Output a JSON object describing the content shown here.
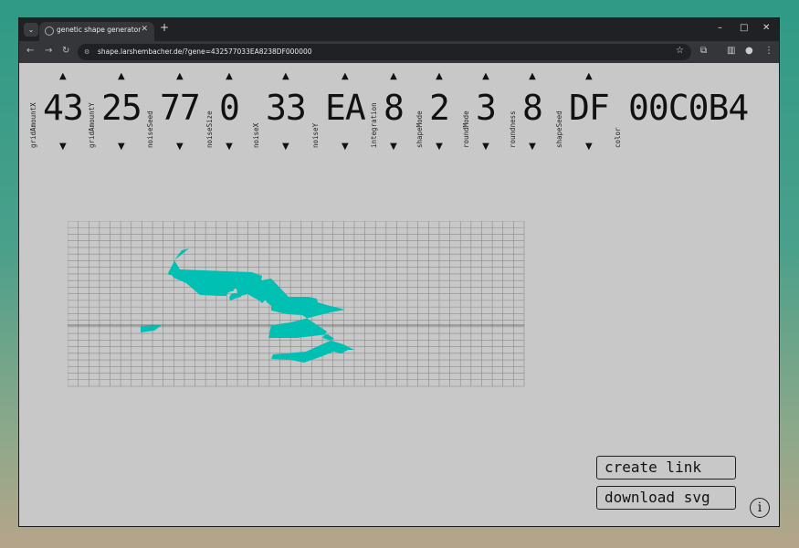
{
  "browser": {
    "tab_title": "genetic shape generator",
    "url": "shape.larshembacher.de/?gene=432577033EA8238DF000000",
    "tab_menu_icon": "chevron-down-icon",
    "new_tab_label": "+",
    "window_controls": [
      "–",
      "□",
      "✕"
    ]
  },
  "params": [
    {
      "label": "gridAmountX",
      "value": "43"
    },
    {
      "label": "gridAmountY",
      "value": "25"
    },
    {
      "label": "noiseSeed",
      "value": "77"
    },
    {
      "label": "noiseSize",
      "value": "0"
    },
    {
      "label": "noiseX",
      "value": "33"
    },
    {
      "label": "noiseY",
      "value": "EA"
    },
    {
      "label": "integration",
      "value": "8"
    },
    {
      "label": "shapeMode",
      "value": "2"
    },
    {
      "label": "roundMode",
      "value": "3"
    },
    {
      "label": "roundness",
      "value": "8"
    },
    {
      "label": "shapeSeed",
      "value": "DF"
    }
  ],
  "color": {
    "label": "color",
    "value": "00C0B4",
    "hex": "#00c0b4"
  },
  "arrows": {
    "up": "▲",
    "down": "▼"
  },
  "buttons": {
    "create_link": "create link",
    "download_svg": "download svg"
  },
  "info_label": "i"
}
